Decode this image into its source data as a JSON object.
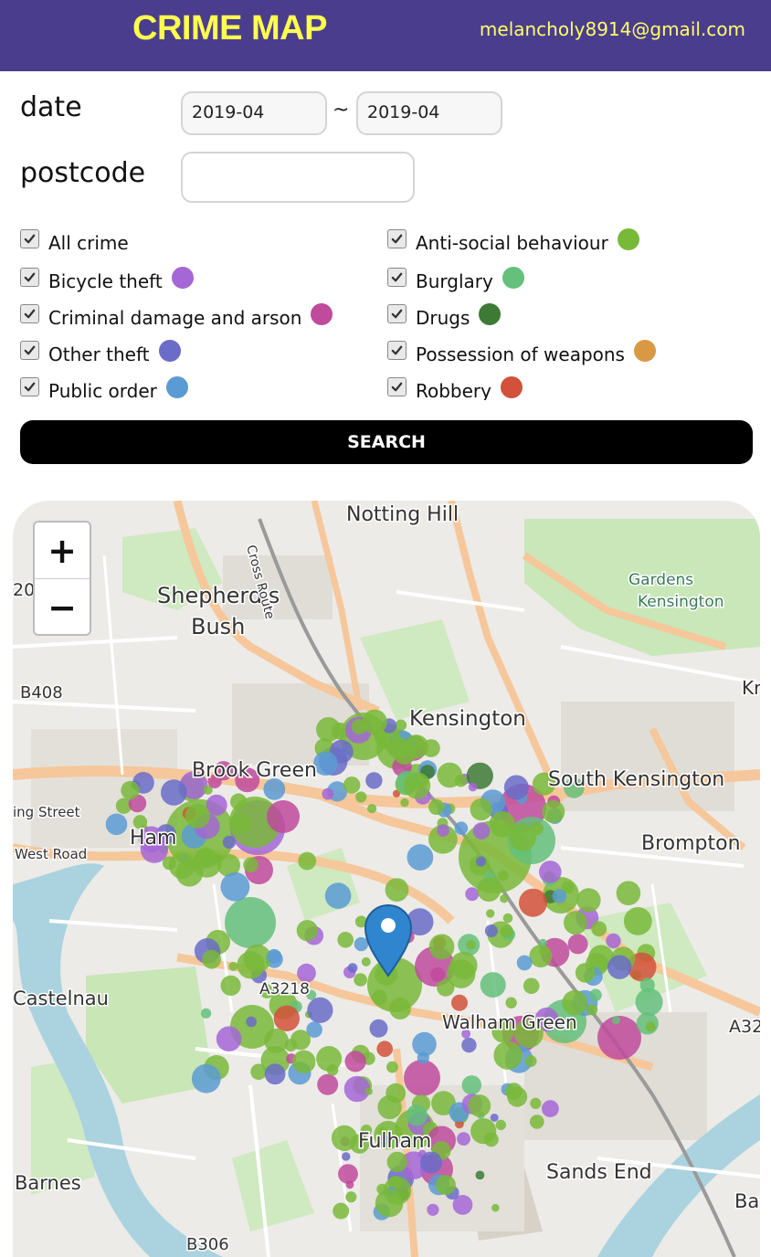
{
  "header": {
    "brand": "CRIME MAP",
    "email": "melancholy8914@gmail.com"
  },
  "filters": {
    "date_label": "date",
    "date_from": "2019-04",
    "separator": "~",
    "date_to": "2019-04",
    "postcode_label": "postcode",
    "postcode_value": ""
  },
  "crime_types": [
    {
      "label": "All crime",
      "checked": true,
      "color": ""
    },
    {
      "label": "Anti-social behaviour",
      "checked": true,
      "color": "#79b93a"
    },
    {
      "label": "Bicycle theft",
      "checked": true,
      "color": "#a566d6"
    },
    {
      "label": "Burglary",
      "checked": true,
      "color": "#64c07a"
    },
    {
      "label": "Criminal damage and arson",
      "checked": true,
      "color": "#c04a9c"
    },
    {
      "label": "Drugs",
      "checked": true,
      "color": "#3d7a35"
    },
    {
      "label": "Other theft",
      "checked": true,
      "color": "#6a6cc8"
    },
    {
      "label": "Possession of weapons",
      "checked": true,
      "color": "#d99944"
    },
    {
      "label": "Public order",
      "checked": true,
      "color": "#5b9bd3"
    },
    {
      "label": "Robbery",
      "checked": true,
      "color": "#d2513a"
    }
  ],
  "search_label": "SEARCH",
  "map": {
    "zoom_in": "+",
    "zoom_out": "−",
    "place_labels": [
      "Notting Hill",
      "Shepherd's",
      "Bush",
      "Kensington",
      "Gardens",
      "Kensington",
      "Brook Green",
      "South Kensington",
      "Brompton",
      "Castelnau",
      "Barnes",
      "Sands End",
      "Fulham",
      "Walham Green",
      "B408",
      "B306",
      "A3218",
      "Cross Route",
      "Ham",
      "West Road",
      "ing Street",
      "Batte",
      "A32",
      "Kr",
      "20"
    ],
    "marker_icon": "location-pin-icon"
  }
}
